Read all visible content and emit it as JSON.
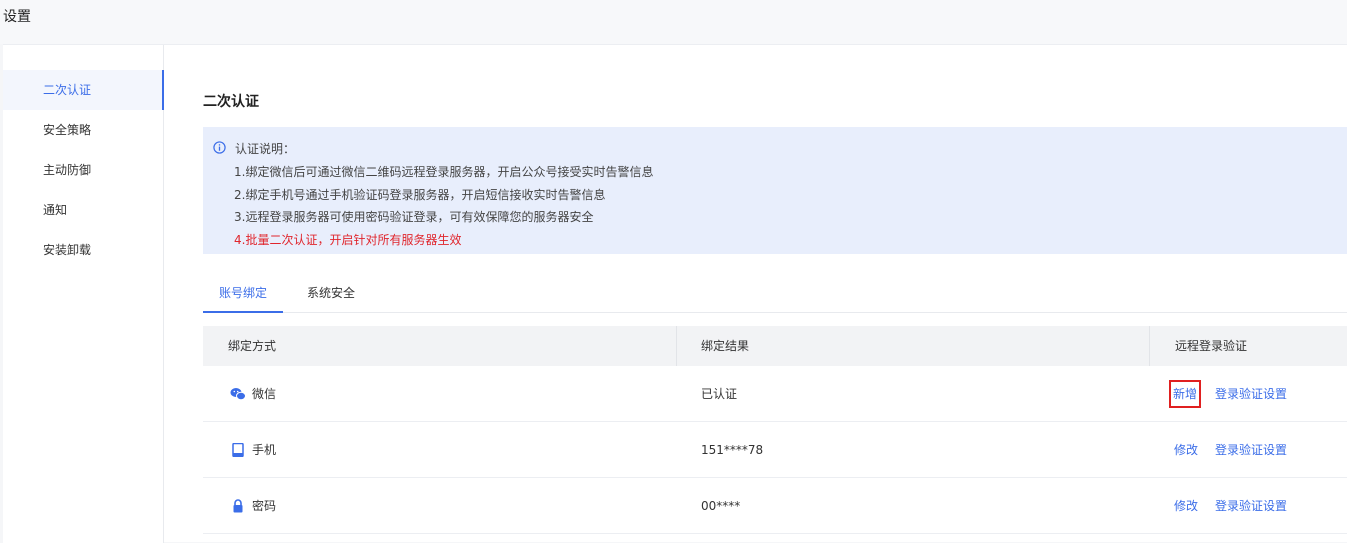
{
  "page": {
    "title": "设置"
  },
  "sidebar": {
    "items": [
      {
        "label": "二次认证",
        "active": true
      },
      {
        "label": "安全策略",
        "active": false
      },
      {
        "label": "主动防御",
        "active": false
      },
      {
        "label": "通知",
        "active": false
      },
      {
        "label": "安装卸载",
        "active": false
      }
    ]
  },
  "main": {
    "section_title": "二次认证",
    "info": {
      "title": "认证说明：",
      "lines": [
        "1.绑定微信后可通过微信二维码远程登录服务器，开启公众号接受实时告警信息",
        "2.绑定手机号通过手机验证码登录服务器，开启短信接收实时告警信息",
        "3.远程登录服务器可使用密码验证登录，可有效保障您的服务器安全"
      ],
      "warning": "4.批量二次认证，开启针对所有服务器生效",
      "icon": "info-circle-icon"
    },
    "tabs": [
      {
        "label": "账号绑定",
        "active": true
      },
      {
        "label": "系统安全",
        "active": false
      }
    ],
    "table": {
      "headers": [
        "绑定方式",
        "绑定结果",
        "远程登录验证"
      ],
      "rows": [
        {
          "icon": "wechat-icon",
          "method": "微信",
          "result": "已认证",
          "action": "新增",
          "setting": "登录验证设置"
        },
        {
          "icon": "phone-icon",
          "method": "手机",
          "result": "151****78",
          "action": "修改",
          "setting": "登录验证设置"
        },
        {
          "icon": "lock-icon",
          "method": "密码",
          "result": "00****",
          "action": "修改",
          "setting": "登录验证设置"
        }
      ]
    }
  },
  "colors": {
    "accent": "#3b6de8",
    "warning": "#e0262d",
    "highlight_box": "#e02020",
    "info_bg": "#e8eefc"
  }
}
